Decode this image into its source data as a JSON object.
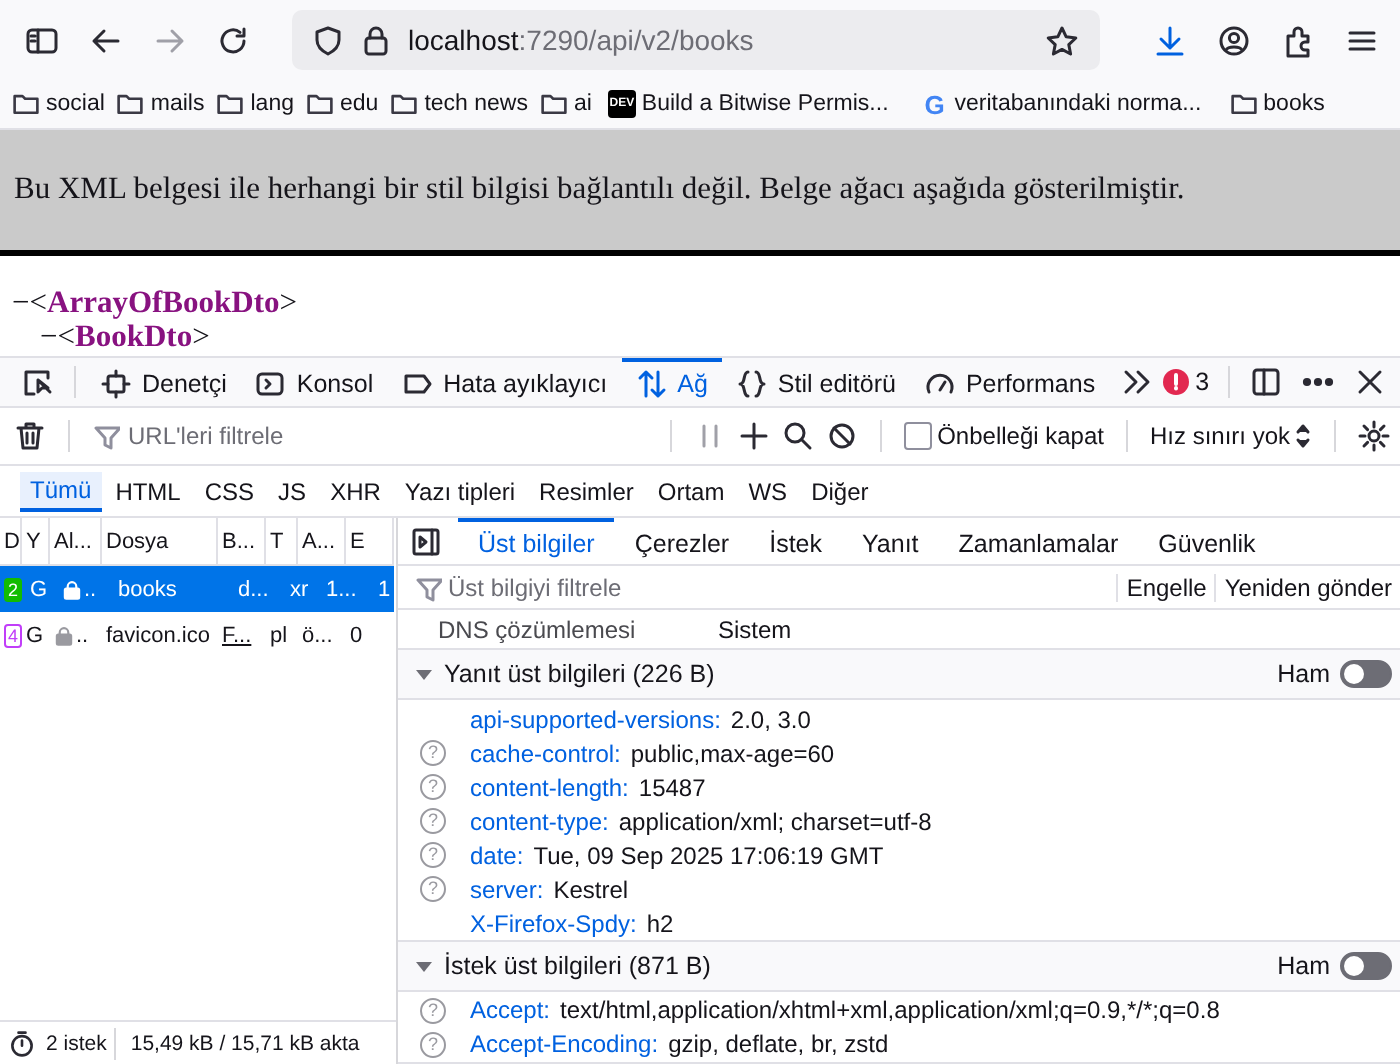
{
  "browser": {
    "address": {
      "host": "localhost",
      "path": ":7290/api/v2/books"
    },
    "bookmarks": [
      {
        "kind": "folder",
        "label": "social"
      },
      {
        "kind": "folder",
        "label": "mails"
      },
      {
        "kind": "folder",
        "label": "lang"
      },
      {
        "kind": "folder",
        "label": "edu"
      },
      {
        "kind": "folder",
        "label": "tech news"
      },
      {
        "kind": "folder",
        "label": "ai"
      },
      {
        "kind": "site",
        "favicon_text": "DEV",
        "label": "Build a Bitwise Permis..."
      },
      {
        "kind": "site",
        "favicon_text": "G",
        "label": "veritabanındaki norma..."
      },
      {
        "kind": "folder",
        "label": "books"
      }
    ]
  },
  "page": {
    "notice": "Bu XML belgesi ile herhangi bir stil bilgisi bağlantılı değil. Belge ağacı aşağıda gösterilmiştir.",
    "xml_tree": [
      {
        "toggle": "−",
        "open": "<",
        "name": "ArrayOfBookDto",
        "close": ">",
        "children": [
          {
            "toggle": "−",
            "open": "<",
            "name": "BookDto",
            "close": ">"
          }
        ]
      }
    ]
  },
  "devtools": {
    "tabs": [
      {
        "label": "Denetçi",
        "selected": false
      },
      {
        "label": "Konsol",
        "selected": false
      },
      {
        "label": "Hata ayıklayıcı",
        "selected": false
      },
      {
        "label": "Ağ",
        "selected": true
      },
      {
        "label": "Stil editörü",
        "selected": false
      },
      {
        "label": "Performans",
        "selected": false
      }
    ],
    "error_count": "3",
    "url_filter": {
      "placeholder": "URL'leri filtrele"
    },
    "disable_cache": {
      "label": "Önbelleği kapat",
      "checked": false
    },
    "throttling": "Hız sınırı yok",
    "type_filters": [
      {
        "label": "Tümü",
        "selected": true
      },
      {
        "label": "HTML",
        "selected": false
      },
      {
        "label": "CSS",
        "selected": false
      },
      {
        "label": "JS",
        "selected": false
      },
      {
        "label": "XHR",
        "selected": false
      },
      {
        "label": "Yazı tipleri",
        "selected": false
      },
      {
        "label": "Resimler",
        "selected": false
      },
      {
        "label": "Ortam",
        "selected": false
      },
      {
        "label": "WS",
        "selected": false
      },
      {
        "label": "Diğer",
        "selected": false
      }
    ],
    "requests": {
      "columns": [
        "D",
        "Y",
        "Al...",
        "Dosya",
        "B...",
        "T",
        "A...",
        "E"
      ],
      "rows": [
        {
          "selected": true,
          "status": "2",
          "color": "#12bc00",
          "method": "G",
          "secure": true,
          "domain": "..",
          "file": "books",
          "initiator": "d...",
          "type": "xr",
          "transferred": "1...",
          "size": "1"
        },
        {
          "selected": false,
          "status": "4",
          "color": "#c13ef9",
          "method": "G",
          "secure": true,
          "domain": "..",
          "file": "favicon.ico",
          "initiator": "F...",
          "type": "pl",
          "transferred": "ö...",
          "size": "0"
        }
      ]
    },
    "status_bar": {
      "requests": "2 istek",
      "transferred": "15,49 kB / 15,71 kB akta"
    },
    "detail_tabs": [
      {
        "label": "Üst bilgiler",
        "selected": true
      },
      {
        "label": "Çerezler",
        "selected": false
      },
      {
        "label": "İstek",
        "selected": false
      },
      {
        "label": "Yanıt",
        "selected": false
      },
      {
        "label": "Zamanlamalar",
        "selected": false
      },
      {
        "label": "Güvenlik",
        "selected": false
      }
    ],
    "header_filter": {
      "placeholder": "Üst bilgiyi filtrele"
    },
    "actions": [
      "Engelle",
      "Yeniden gönder"
    ],
    "dns": {
      "label": "DNS çözümlemesi",
      "value": "Sistem"
    },
    "sections": [
      {
        "title": "Yanıt üst bilgileri (226 B)",
        "expanded": true,
        "raw_label": "Ham",
        "raw_on": false,
        "headers": [
          {
            "name": "api-supported-versions:",
            "value": "2.0, 3.0"
          },
          {
            "help": "?",
            "name": "cache-control:",
            "value": "public,max-age=60"
          },
          {
            "help": "?",
            "name": "content-length:",
            "value": "15487"
          },
          {
            "help": "?",
            "name": "content-type:",
            "value": "application/xml; charset=utf-8"
          },
          {
            "help": "?",
            "name": "date:",
            "value": "Tue, 09 Sep 2025 17:06:19 GMT"
          },
          {
            "help": "?",
            "name": "server:",
            "value": "Kestrel"
          },
          {
            "name": "X-Firefox-Spdy:",
            "value": "h2"
          }
        ]
      },
      {
        "title": "İstek üst bilgileri (871 B)",
        "expanded": true,
        "raw_label": "Ham",
        "raw_on": false,
        "headers": [
          {
            "help": "?",
            "name": "Accept:",
            "value": "text/html,application/xhtml+xml,application/xml;q=0.9,*/*;q=0.8"
          },
          {
            "help": "?",
            "name": "Accept-Encoding:",
            "value": "gzip, deflate, br, zstd"
          }
        ]
      }
    ]
  }
}
